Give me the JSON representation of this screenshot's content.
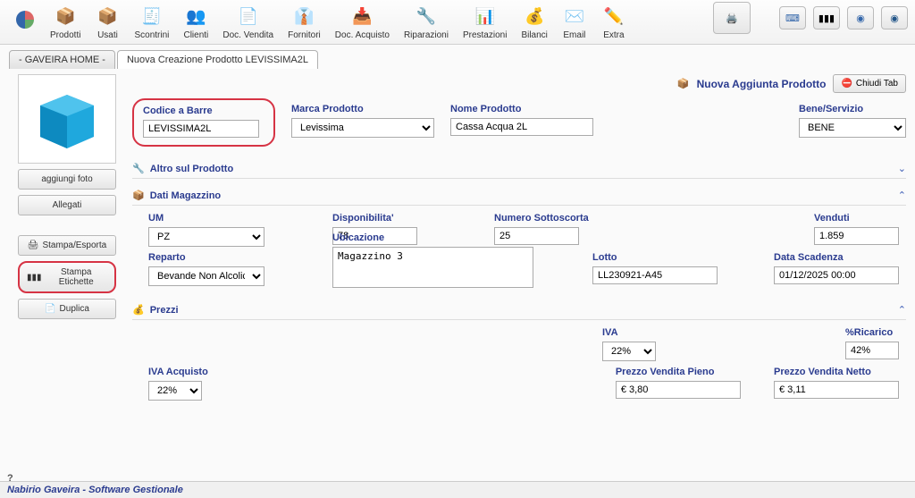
{
  "toolbar": {
    "items": [
      {
        "label": "Prodotti"
      },
      {
        "label": "Usati"
      },
      {
        "label": "Scontrini"
      },
      {
        "label": "Clienti"
      },
      {
        "label": "Doc. Vendita"
      },
      {
        "label": "Fornitori"
      },
      {
        "label": "Doc. Acquisto"
      },
      {
        "label": "Riparazioni"
      },
      {
        "label": "Prestazioni"
      },
      {
        "label": "Bilanci"
      },
      {
        "label": "Email"
      },
      {
        "label": "Extra"
      }
    ]
  },
  "tabs": {
    "home": "- GAVEIRA HOME -",
    "current": "Nuova Creazione Prodotto LEVISSIMA2L"
  },
  "sidebar": {
    "add_photo": "aggiungi foto",
    "attachments": "Allegati",
    "print_export": "Stampa/Esporta",
    "print_labels": "Stampa Etichette",
    "duplicate": "Duplica"
  },
  "header": {
    "title": "Nuova Aggiunta Prodotto",
    "close_tab": "Chiudi Tab"
  },
  "fields": {
    "barcode_label": "Codice a Barre",
    "barcode_value": "LEVISSIMA2L",
    "brand_label": "Marca Prodotto",
    "brand_value": "Levissima",
    "name_label": "Nome Prodotto",
    "name_value": "Cassa Acqua 2L",
    "type_label": "Bene/Servizio",
    "type_value": "BENE"
  },
  "sections": {
    "more": "Altro sul Prodotto",
    "warehouse": "Dati Magazzino",
    "prices": "Prezzi"
  },
  "warehouse": {
    "um_label": "UM",
    "um_value": "PZ",
    "reparto_label": "Reparto",
    "reparto_value": "Bevande Non Alcoliche",
    "disp_label": "Disponibilita'",
    "disp_value": "78",
    "ubic_label": "Ubicazione",
    "ubic_value": "Magazzino 3",
    "sotto_label": "Numero Sottoscorta",
    "sotto_value": "25",
    "lotto_label": "Lotto",
    "lotto_value": "LL230921-A45",
    "venduti_label": "Venduti",
    "venduti_value": "1.859",
    "scadenza_label": "Data Scadenza",
    "scadenza_value": "01/12/2025 00:00"
  },
  "prices": {
    "iva_label": "IVA",
    "iva_value": "22%",
    "ricarico_label": "%Ricarico",
    "ricarico_value": "42%",
    "iva_acq_label": "IVA Acquisto",
    "iva_acq_value": "22%",
    "pvp_label": "Prezzo Vendita Pieno",
    "pvp_value": "€ 3,80",
    "pvn_label": "Prezzo Vendita Netto",
    "pvn_value": "€ 3,11"
  },
  "footer": {
    "text": "Nabirio Gaveira - Software Gestionale",
    "help": "?"
  }
}
